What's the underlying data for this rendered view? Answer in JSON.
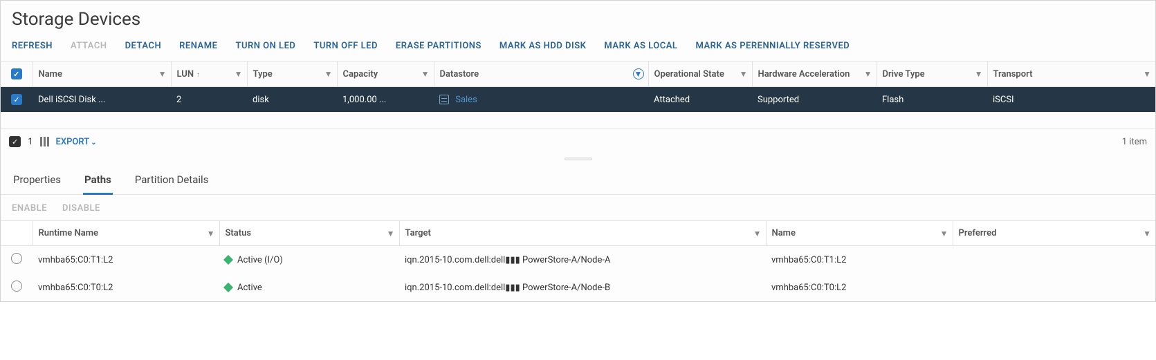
{
  "title": "Storage Devices",
  "toolbar": {
    "refresh": "REFRESH",
    "attach": "ATTACH",
    "detach": "DETACH",
    "rename": "RENAME",
    "turn_on_led": "TURN ON LED",
    "turn_off_led": "TURN OFF LED",
    "erase_partitions": "ERASE PARTITIONS",
    "mark_hdd": "MARK AS HDD DISK",
    "mark_local": "MARK AS LOCAL",
    "mark_perennial": "MARK AS PERENNIALLY RESERVED"
  },
  "columns": {
    "name": "Name",
    "lun": "LUN",
    "type": "Type",
    "capacity": "Capacity",
    "datastore": "Datastore",
    "op_state": "Operational State",
    "hw_accel": "Hardware Acceleration",
    "drive_type": "Drive Type",
    "transport": "Transport"
  },
  "row": {
    "name": "Dell     iSCSI Disk ...",
    "lun": "2",
    "type": "disk",
    "capacity": "1,000.00 ...",
    "datastore": "Sales",
    "op_state": "Attached",
    "hw_accel": "Supported",
    "drive_type": "Flash",
    "transport": "iSCSI"
  },
  "footer": {
    "selected_count": "1",
    "export": "EXPORT",
    "item_count": "1 item"
  },
  "tabs": {
    "properties": "Properties",
    "paths": "Paths",
    "partition": "Partition Details"
  },
  "paths_toolbar": {
    "enable": "ENABLE",
    "disable": "DISABLE"
  },
  "paths_columns": {
    "runtime": "Runtime Name",
    "status": "Status",
    "target": "Target",
    "name": "Name",
    "preferred": "Preferred"
  },
  "paths": [
    {
      "runtime": "vmhba65:C0:T1:L2",
      "status": "Active (I/O)",
      "target": "iqn.2015-10.com.dell:dell▮▮▮ PowerStore-A/Node-A",
      "name": "vmhba65:C0:T1:L2",
      "preferred": ""
    },
    {
      "runtime": "vmhba65:C0:T0:L2",
      "status": "Active",
      "target": "iqn.2015-10.com.dell:dell▮▮▮ PowerStore-A/Node-B",
      "name": "vmhba65:C0:T0:L2",
      "preferred": ""
    }
  ]
}
